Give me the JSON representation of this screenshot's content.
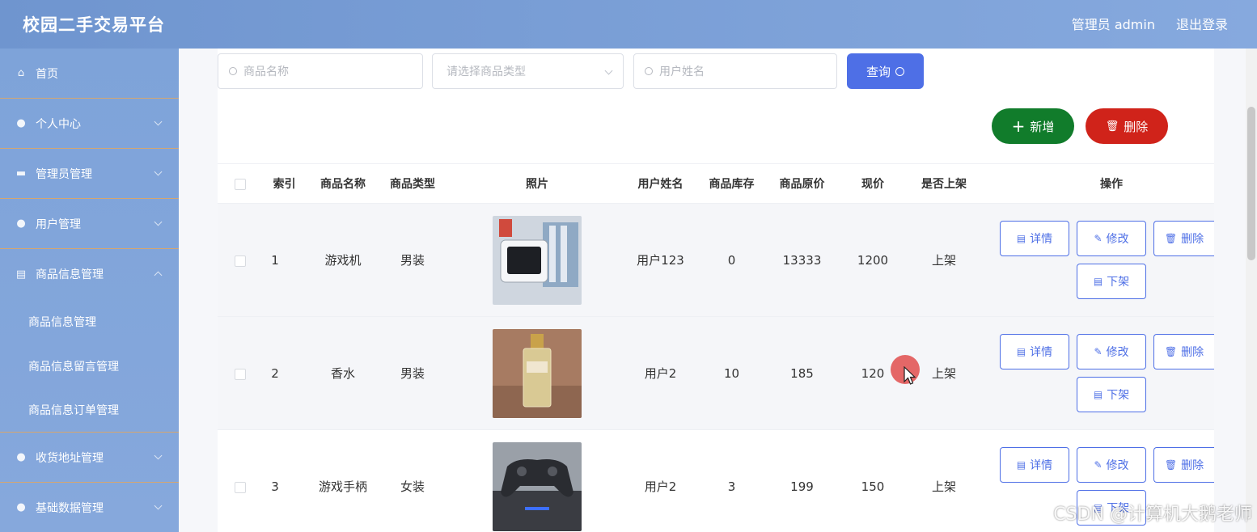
{
  "header": {
    "title": "校园二手交易平台",
    "user_label": "管理员 admin",
    "logout_label": "退出登录"
  },
  "sidebar": {
    "items": [
      {
        "label": "首页",
        "icon": "home-icon"
      },
      {
        "label": "个人中心",
        "icon": "user-icon"
      },
      {
        "label": "管理员管理",
        "icon": "folder-icon"
      },
      {
        "label": "用户管理",
        "icon": "folder-icon"
      },
      {
        "label": "商品信息管理",
        "icon": "folder-icon"
      }
    ],
    "submenu": [
      "商品信息管理",
      "商品信息留言管理",
      "商品信息订单管理"
    ],
    "items_after": [
      {
        "label": "收货地址管理",
        "icon": "user-icon"
      },
      {
        "label": "基础数据管理",
        "icon": "pin-icon"
      }
    ]
  },
  "search": {
    "name_placeholder": "商品名称",
    "type_placeholder": "请选择商品类型",
    "user_placeholder": "用户姓名",
    "query_label": "查询"
  },
  "toolbar": {
    "add_label": "新增",
    "delete_label": "删除"
  },
  "table": {
    "headers": [
      "索引",
      "商品名称",
      "商品类型",
      "照片",
      "用户姓名",
      "商品库存",
      "商品原价",
      "现价",
      "是否上架",
      "操作"
    ],
    "rows": [
      {
        "index": "1",
        "name": "游戏机",
        "type": "男装",
        "user": "用户123",
        "stock": "0",
        "orig_price": "13333",
        "price": "1200",
        "status": "上架"
      },
      {
        "index": "2",
        "name": "香水",
        "type": "男装",
        "user": "用户2",
        "stock": "10",
        "orig_price": "185",
        "price": "120",
        "status": "上架"
      },
      {
        "index": "3",
        "name": "游戏手柄",
        "type": "女装",
        "user": "用户2",
        "stock": "3",
        "orig_price": "199",
        "price": "150",
        "status": "上架"
      }
    ],
    "actions": {
      "detail": "详情",
      "edit": "修改",
      "delete": "删除",
      "offshelf": "下架"
    }
  },
  "watermark": "CSDN @计算机大鹅老师",
  "colors": {
    "primary": "#4e6fe6",
    "success": "#117c2b",
    "danger": "#d0231a",
    "sidebar": "#7ea3d9"
  }
}
